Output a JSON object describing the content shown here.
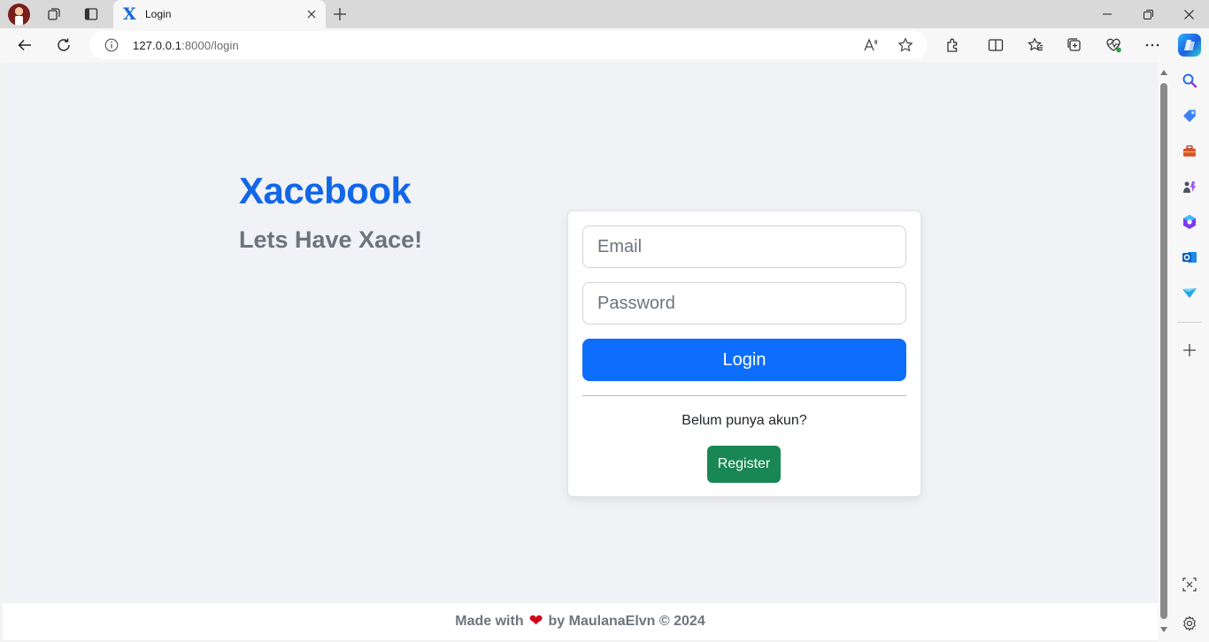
{
  "browser": {
    "tab": {
      "title": "Login",
      "favicon": "X"
    },
    "address": {
      "host": "127.0.0.1",
      "rest": ":8000/login"
    }
  },
  "page": {
    "brand": "Xacebook",
    "tagline": "Lets Have Xace!",
    "form": {
      "email_placeholder": "Email",
      "password_placeholder": "Password",
      "login_label": "Login",
      "no_account_text": "Belum punya akun?",
      "register_label": "Register"
    },
    "footer": {
      "prefix": "Made with",
      "suffix": "by MaulanaElvn © 2024"
    }
  },
  "colors": {
    "brand": "#1266e8",
    "primary": "#0d6efd",
    "success": "#198754",
    "muted": "#6c757d",
    "page_bg": "#f0f2f5"
  },
  "icons": {
    "toolbar": [
      "back-icon",
      "refresh-icon",
      "info-icon",
      "read-aloud-icon",
      "favorite-star-icon",
      "extensions-icon",
      "split-screen-icon",
      "favorites-icon",
      "collections-icon",
      "browser-essentials-icon",
      "more-icon",
      "copilot-icon"
    ],
    "sidebar": [
      "search-icon",
      "shopping-tag-icon",
      "tools-icon",
      "games-icon",
      "microsoft365-icon",
      "outlook-icon",
      "drop-icon",
      "add-icon",
      "screenshot-icon",
      "settings-icon"
    ]
  }
}
